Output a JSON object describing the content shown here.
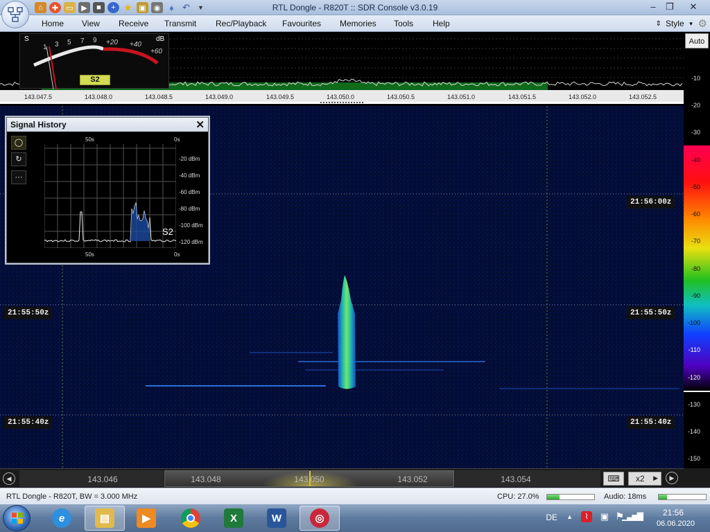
{
  "window": {
    "title": "RTL Dongle - R820T :: SDR Console v3.0.19",
    "controls": [
      "minimize-icon",
      "maximize-icon",
      "close-icon"
    ]
  },
  "quick_access": [
    "home-icon",
    "lifebuoy-icon",
    "folder-icon",
    "play-icon",
    "stop-icon",
    "add-icon",
    "star-icon",
    "lock-icon",
    "camera-icon",
    "drop-icon",
    "undo-icon",
    "dropdown-icon"
  ],
  "menu": {
    "items": [
      "Home",
      "View",
      "Receive",
      "Transmit",
      "Rec/Playback",
      "Favourites",
      "Memories",
      "Tools",
      "Help"
    ],
    "style_label": "Style"
  },
  "smeter": {
    "s_label": "S",
    "db_label": "dB",
    "scale": [
      "1",
      "3",
      "5",
      "7",
      "9",
      "+20",
      "+40",
      "+60"
    ],
    "reading": "S2"
  },
  "spectrum": {
    "auto_label": "Auto",
    "freq_labels": [
      "143.047.5",
      "143.048.0",
      "143.048.5",
      "143.049.0",
      "143.049.5",
      "143.050.0",
      "143.050.5",
      "143.051.0",
      "143.051.5",
      "143.052.0",
      "143.052.5"
    ]
  },
  "db_scale": [
    "-10",
    "-20",
    "-30",
    "-40",
    "-50",
    "-60",
    "-70",
    "-80",
    "-90",
    "-100",
    "-110",
    "-120",
    "-130",
    "-140",
    "-150"
  ],
  "waterfall": {
    "time_labels": [
      "21:56:00z",
      "21:55:50z",
      "21:55:50z",
      "21:55:40z",
      "21:55:40z"
    ]
  },
  "signal_history": {
    "title": "Signal History",
    "top_labels": [
      "50s",
      "0s"
    ],
    "bottom_labels": [
      "50s",
      "0s"
    ],
    "db_labels": [
      "-20 dBm",
      "-40 dBm",
      "-60 dBm",
      "-80 dBm",
      "-100 dBm",
      "-120 dBm"
    ],
    "reading": "S2",
    "tools": [
      "circle-icon",
      "refresh-icon",
      "more-icon"
    ]
  },
  "bottom_scale": {
    "labels": [
      "143.046",
      "143.048",
      "143.050",
      "143.052",
      "143.054"
    ],
    "zoom": "x2"
  },
  "status": {
    "device": "RTL Dongle - R820T, BW = 3.000 MHz",
    "cpu": "CPU: 27.0%",
    "cpu_level": 0.27,
    "audio": "Audio: 18ms",
    "audio_level": 0.18
  },
  "taskbar": {
    "apps": [
      "internet-explorer-icon",
      "file-explorer-icon",
      "media-player-icon",
      "chrome-icon",
      "excel-icon",
      "word-icon",
      "sdr-console-icon"
    ],
    "language": "DE",
    "time": "21:56",
    "date": "06.06.2020"
  },
  "colors": {
    "waterfall_bg": "#020a2c",
    "signal": "#3fd3a0",
    "meter_red": "#c8141e",
    "accent": "#d8e060"
  }
}
